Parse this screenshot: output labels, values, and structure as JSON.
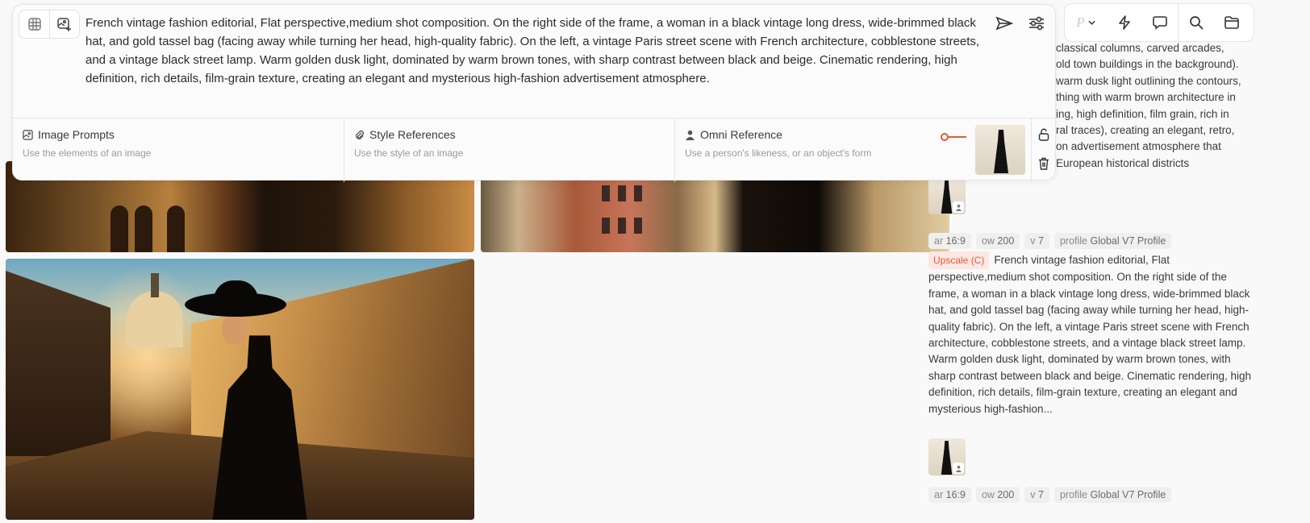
{
  "prompt": {
    "text": "French vintage fashion editorial, Flat perspective,medium shot composition. On the right side of the frame, a woman in a black vintage long dress, wide-brimmed black hat, and gold tassel bag (facing away while turning her head, high-quality fabric). On the left, a vintage Paris street scene with French architecture, cobblestone streets, and a vintage black street lamp. Warm golden dusk light, dominated by warm brown tones, with sharp contrast between black and beige. Cinematic rendering, high definition, rich details, film-grain texture, creating an elegant and mysterious high-fashion advertisement atmosphere."
  },
  "references": {
    "image_prompts": {
      "title": "Image Prompts",
      "subtitle": "Use the elements of an image"
    },
    "style_references": {
      "title": "Style References",
      "subtitle": "Use the style of an image"
    },
    "omni_reference": {
      "title": "Omni Reference",
      "subtitle": "Use a person's likeness, or an object's form"
    }
  },
  "toolbar": {
    "personalize_label": "P"
  },
  "jobs": [
    {
      "text_lines": [
        "classical columns, carved arcades,",
        "old town buildings in the background).",
        "warm dusk light outlining the contours,",
        "thing with warm brown architecture in",
        "ing, high definition, film grain, rich in",
        "ral traces), creating an elegant, retro,",
        "on advertisement atmosphere that",
        "European historical districts"
      ],
      "tags": [
        {
          "key": "ar",
          "value": "16:9"
        },
        {
          "key": "ow",
          "value": "200"
        },
        {
          "key": "v",
          "value": "7"
        },
        {
          "key": "profile",
          "value": "Global V7 Profile"
        }
      ]
    },
    {
      "badge": "Upscale (C)",
      "text": "French vintage fashion editorial, Flat perspective,medium shot composition. On the right side of the frame, a woman in a black vintage long dress, wide-brimmed black hat, and gold tassel bag (facing away while turning her head, high-quality fabric). On the left, a vintage Paris street scene with French architecture, cobblestone streets, and a vintage black street lamp. Warm golden dusk light, dominated by warm brown tones, with sharp contrast between black and beige. Cinematic rendering, high definition, rich details, film-grain texture, creating an elegant and mysterious high-fashion...",
      "tags": [
        {
          "key": "ar",
          "value": "16:9"
        },
        {
          "key": "ow",
          "value": "200"
        },
        {
          "key": "v",
          "value": "7"
        },
        {
          "key": "profile",
          "value": "Global V7 Profile"
        }
      ]
    }
  ],
  "colors": {
    "accent": "#e25a3a",
    "tag_bg": "#efefef"
  }
}
